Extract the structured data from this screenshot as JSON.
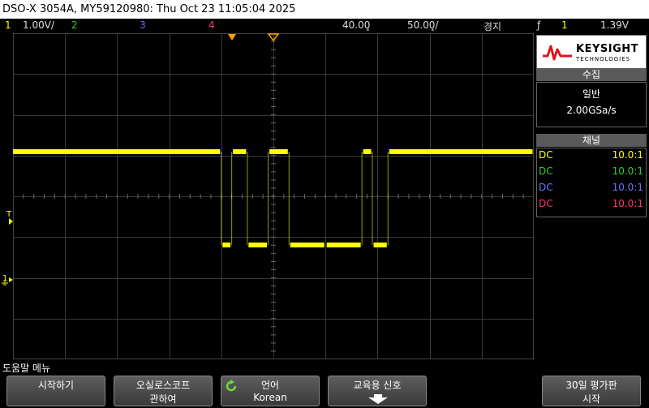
{
  "title": "DSO-X 3054A, MY59120980: Thu Oct 23 11:05:04 2025",
  "status": {
    "ch1_num": "1",
    "ch1_scale": "1.00V/",
    "ch2_num": "2",
    "ch3_num": "3",
    "ch4_num": "4",
    "time_pos": "40.00͓",
    "time_scale": "50.00͓/",
    "mode": "경지",
    "trig_slope": "ƒ",
    "trig_src": "1",
    "trig_level": "1.39V"
  },
  "colors": {
    "ch1": "#ffff00",
    "ch2": "#33cc33",
    "ch3": "#6f6fff",
    "ch4": "#ff3377",
    "trigger_marker": "#ff9900"
  },
  "markers": {
    "trigger_label": "T",
    "ground_label": "1"
  },
  "panel": {
    "brand": "KEYSIGHT",
    "brand_sub": "TECHNOLOGIES",
    "acq_header": "수집",
    "acq_mode": "일반",
    "acq_rate": "2.00GSa/s",
    "ch_header": "채널",
    "channels": [
      {
        "coupling": "DC",
        "probe": "10.0:1"
      },
      {
        "coupling": "DC",
        "probe": "10.0:1"
      },
      {
        "coupling": "DC",
        "probe": "10.0:1"
      },
      {
        "coupling": "DC",
        "probe": "10.0:1"
      }
    ]
  },
  "menu": {
    "title": "도움말 메뉴",
    "buttons": [
      {
        "l1": "시작하기",
        "l2": ""
      },
      {
        "l1": "오실로스코프",
        "l2": "관하여"
      },
      {
        "l1": "언어",
        "l2": "Korean"
      },
      {
        "l1": "교육용 신호",
        "l2": ""
      },
      {
        "l1": "30일 평가판",
        "l2": "시작"
      }
    ]
  },
  "waveform": {
    "high_v": 1.0,
    "low_v": -1.0,
    "segments": [
      [
        0,
        0.4
      ],
      [
        0.4,
        0.42
      ],
      [
        0.42,
        0.45
      ],
      [
        0.45,
        0.49
      ],
      [
        0.49,
        0.53
      ],
      [
        0.53,
        0.6
      ],
      [
        0.6,
        0.67
      ],
      [
        0.67,
        0.69
      ],
      [
        0.69,
        0.72
      ],
      [
        0.72,
        1
      ]
    ],
    "levels": [
      1,
      0,
      1,
      0,
      1,
      0,
      0,
      1,
      0,
      1
    ]
  }
}
